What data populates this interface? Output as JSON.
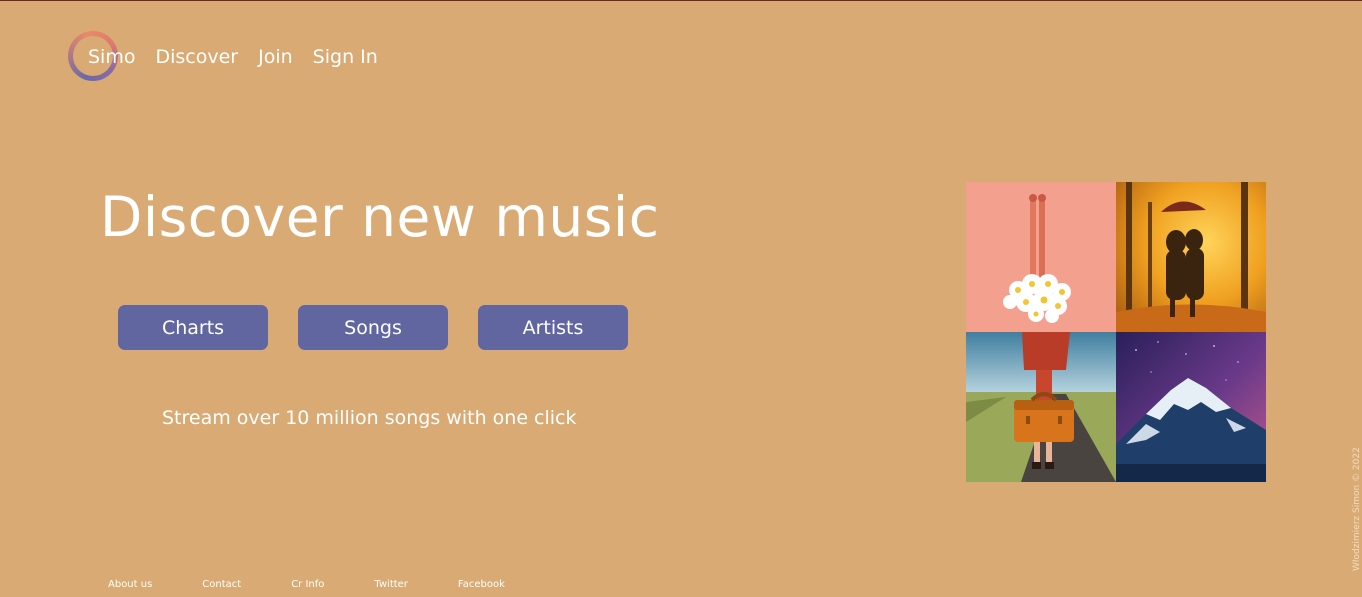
{
  "nav": {
    "brand": "Simo",
    "links": [
      "Discover",
      "Join",
      "Sign In"
    ]
  },
  "hero": {
    "title": "Discover new music",
    "buttons": [
      "Charts",
      "Songs",
      "Artists"
    ],
    "tagline": "Stream over 10 million songs with one click"
  },
  "gallery": {
    "tiles": [
      "legs-with-daisies-image",
      "autumn-couple-umbrella-image",
      "woman-with-suitcase-image",
      "snowy-mountain-night-sky-image"
    ]
  },
  "footer": {
    "links": [
      "About us",
      "Contact",
      "Cr Info",
      "Twitter",
      "Facebook"
    ],
    "credit": "Włodzimierz Simon © 2022"
  },
  "colors": {
    "background": "#d9aa73",
    "button": "#6166a0",
    "text": "#ffffff"
  }
}
